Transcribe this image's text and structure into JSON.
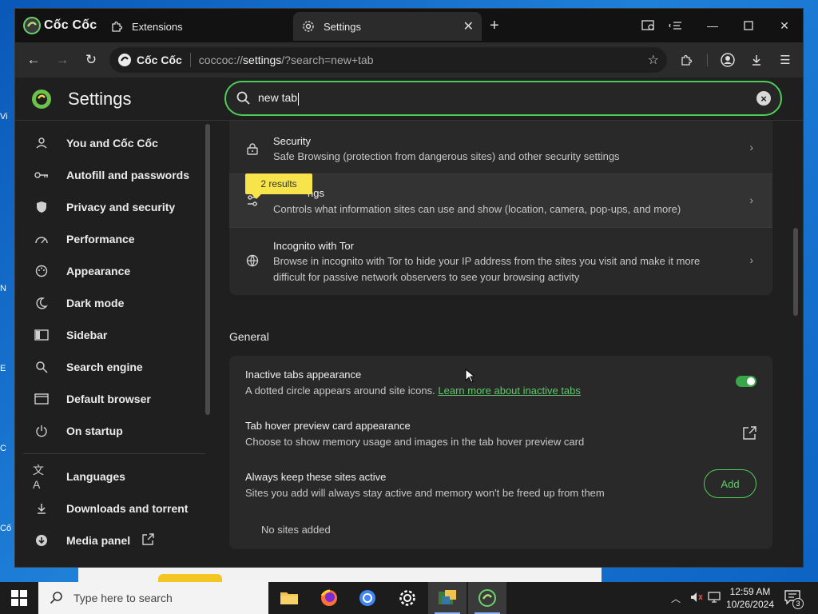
{
  "browser": {
    "brand": "Cốc Cốc",
    "tabs": [
      {
        "label": "Extensions",
        "icon": "puzzle-icon"
      },
      {
        "label": "Settings",
        "icon": "gear-icon",
        "active": true
      }
    ],
    "new_tab_symbol": "+",
    "omnibox": {
      "brand": "Cốc Cốc",
      "url_prefix": "coccoc://",
      "url_host": "settings",
      "url_rest": "/?search=new+tab"
    }
  },
  "settings": {
    "title": "Settings",
    "search": {
      "value": "new tab"
    },
    "nav": [
      {
        "label": "You and Cốc Cốc",
        "icon": "person-icon"
      },
      {
        "label": "Autofill and passwords",
        "icon": "key-icon"
      },
      {
        "label": "Privacy and security",
        "icon": "shield-icon"
      },
      {
        "label": "Performance",
        "icon": "speedometer-icon"
      },
      {
        "label": "Appearance",
        "icon": "palette-icon"
      },
      {
        "label": "Dark mode",
        "icon": "moon-icon"
      },
      {
        "label": "Sidebar",
        "icon": "sidebar-icon"
      },
      {
        "label": "Search engine",
        "icon": "search-icon"
      },
      {
        "label": "Default browser",
        "icon": "browser-window-icon"
      },
      {
        "label": "On startup",
        "icon": "power-icon"
      },
      {
        "label": "Languages",
        "icon": "translate-icon"
      },
      {
        "label": "Downloads and torrent",
        "icon": "download-icon"
      },
      {
        "label": "Media panel",
        "icon": "media-icon"
      }
    ],
    "results_badge": "2 results",
    "privacy_rows": [
      {
        "title": "Security",
        "desc": "Safe Browsing (protection from dangerous sites) and other security settings"
      },
      {
        "title": "Site settings",
        "title_visible": "ngs",
        "desc": "Controls what information sites can use and show (location, camera, pop-ups, and more)"
      },
      {
        "title": "Incognito with Tor",
        "desc_line1": "Browse in incognito with Tor to hide your IP address from the sites you visit and make it more",
        "desc_line2": "difficult for passive network observers to see your browsing activity"
      }
    ],
    "general": {
      "section_title": "General",
      "inactive_tabs": {
        "title": "Inactive tabs appearance",
        "desc": "A dotted circle appears around site icons.",
        "link": "Learn more about inactive tabs",
        "enabled": true
      },
      "hover_preview": {
        "title": "Tab hover preview card appearance",
        "desc": "Choose to show memory usage and images in the tab hover preview card"
      },
      "keep_active": {
        "title": "Always keep these sites active",
        "desc": "Sites you add will always stay active and memory won't be freed up from them",
        "button": "Add",
        "empty": "No sites added"
      }
    }
  },
  "taskbar": {
    "search_placeholder": "Type here to search",
    "time": "12:59 AM",
    "date": "10/26/2024",
    "notification_count": "3"
  },
  "colors": {
    "accent": "#4ccf58",
    "badge": "#f7e44a",
    "window_bg": "#1f1f1f",
    "card_bg": "#292929"
  }
}
